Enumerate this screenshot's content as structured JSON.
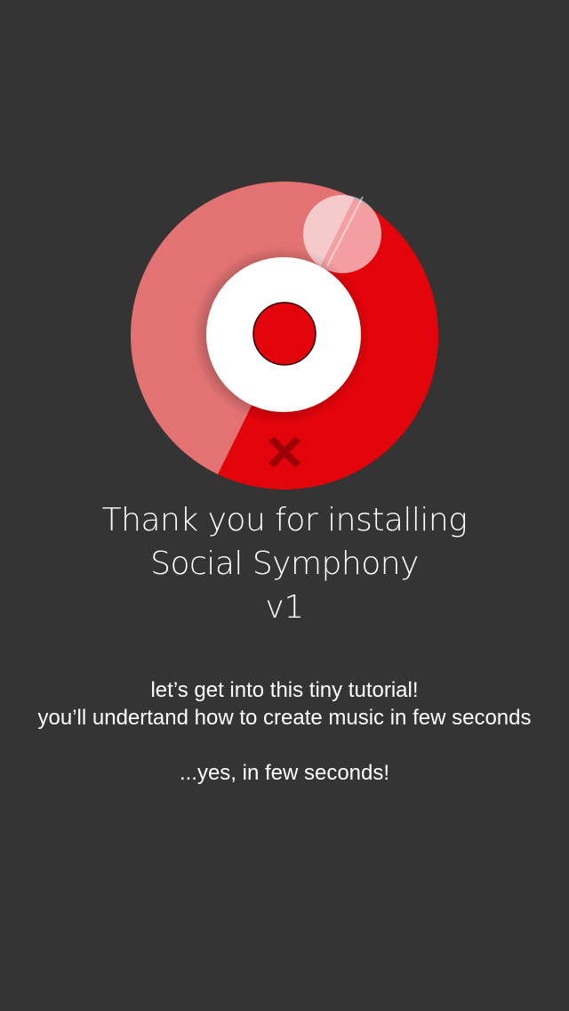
{
  "app": {
    "name": "Social Symphony"
  },
  "logo": {
    "icon": "record-disc-icon",
    "close_icon": "close-x-icon",
    "colors": {
      "primary_red": "#e3040b",
      "light_red": "#e37373",
      "dark_red": "#9c0006",
      "background": "#343434"
    }
  },
  "header": {
    "line1": "Thank you for installing",
    "line2": "Social Symphony",
    "version": "v1"
  },
  "intro": {
    "line1": "let’s get into this tiny tutorial!",
    "line2": "you’ll undertand how to create music in few seconds",
    "line3": "...yes, in few seconds!"
  }
}
